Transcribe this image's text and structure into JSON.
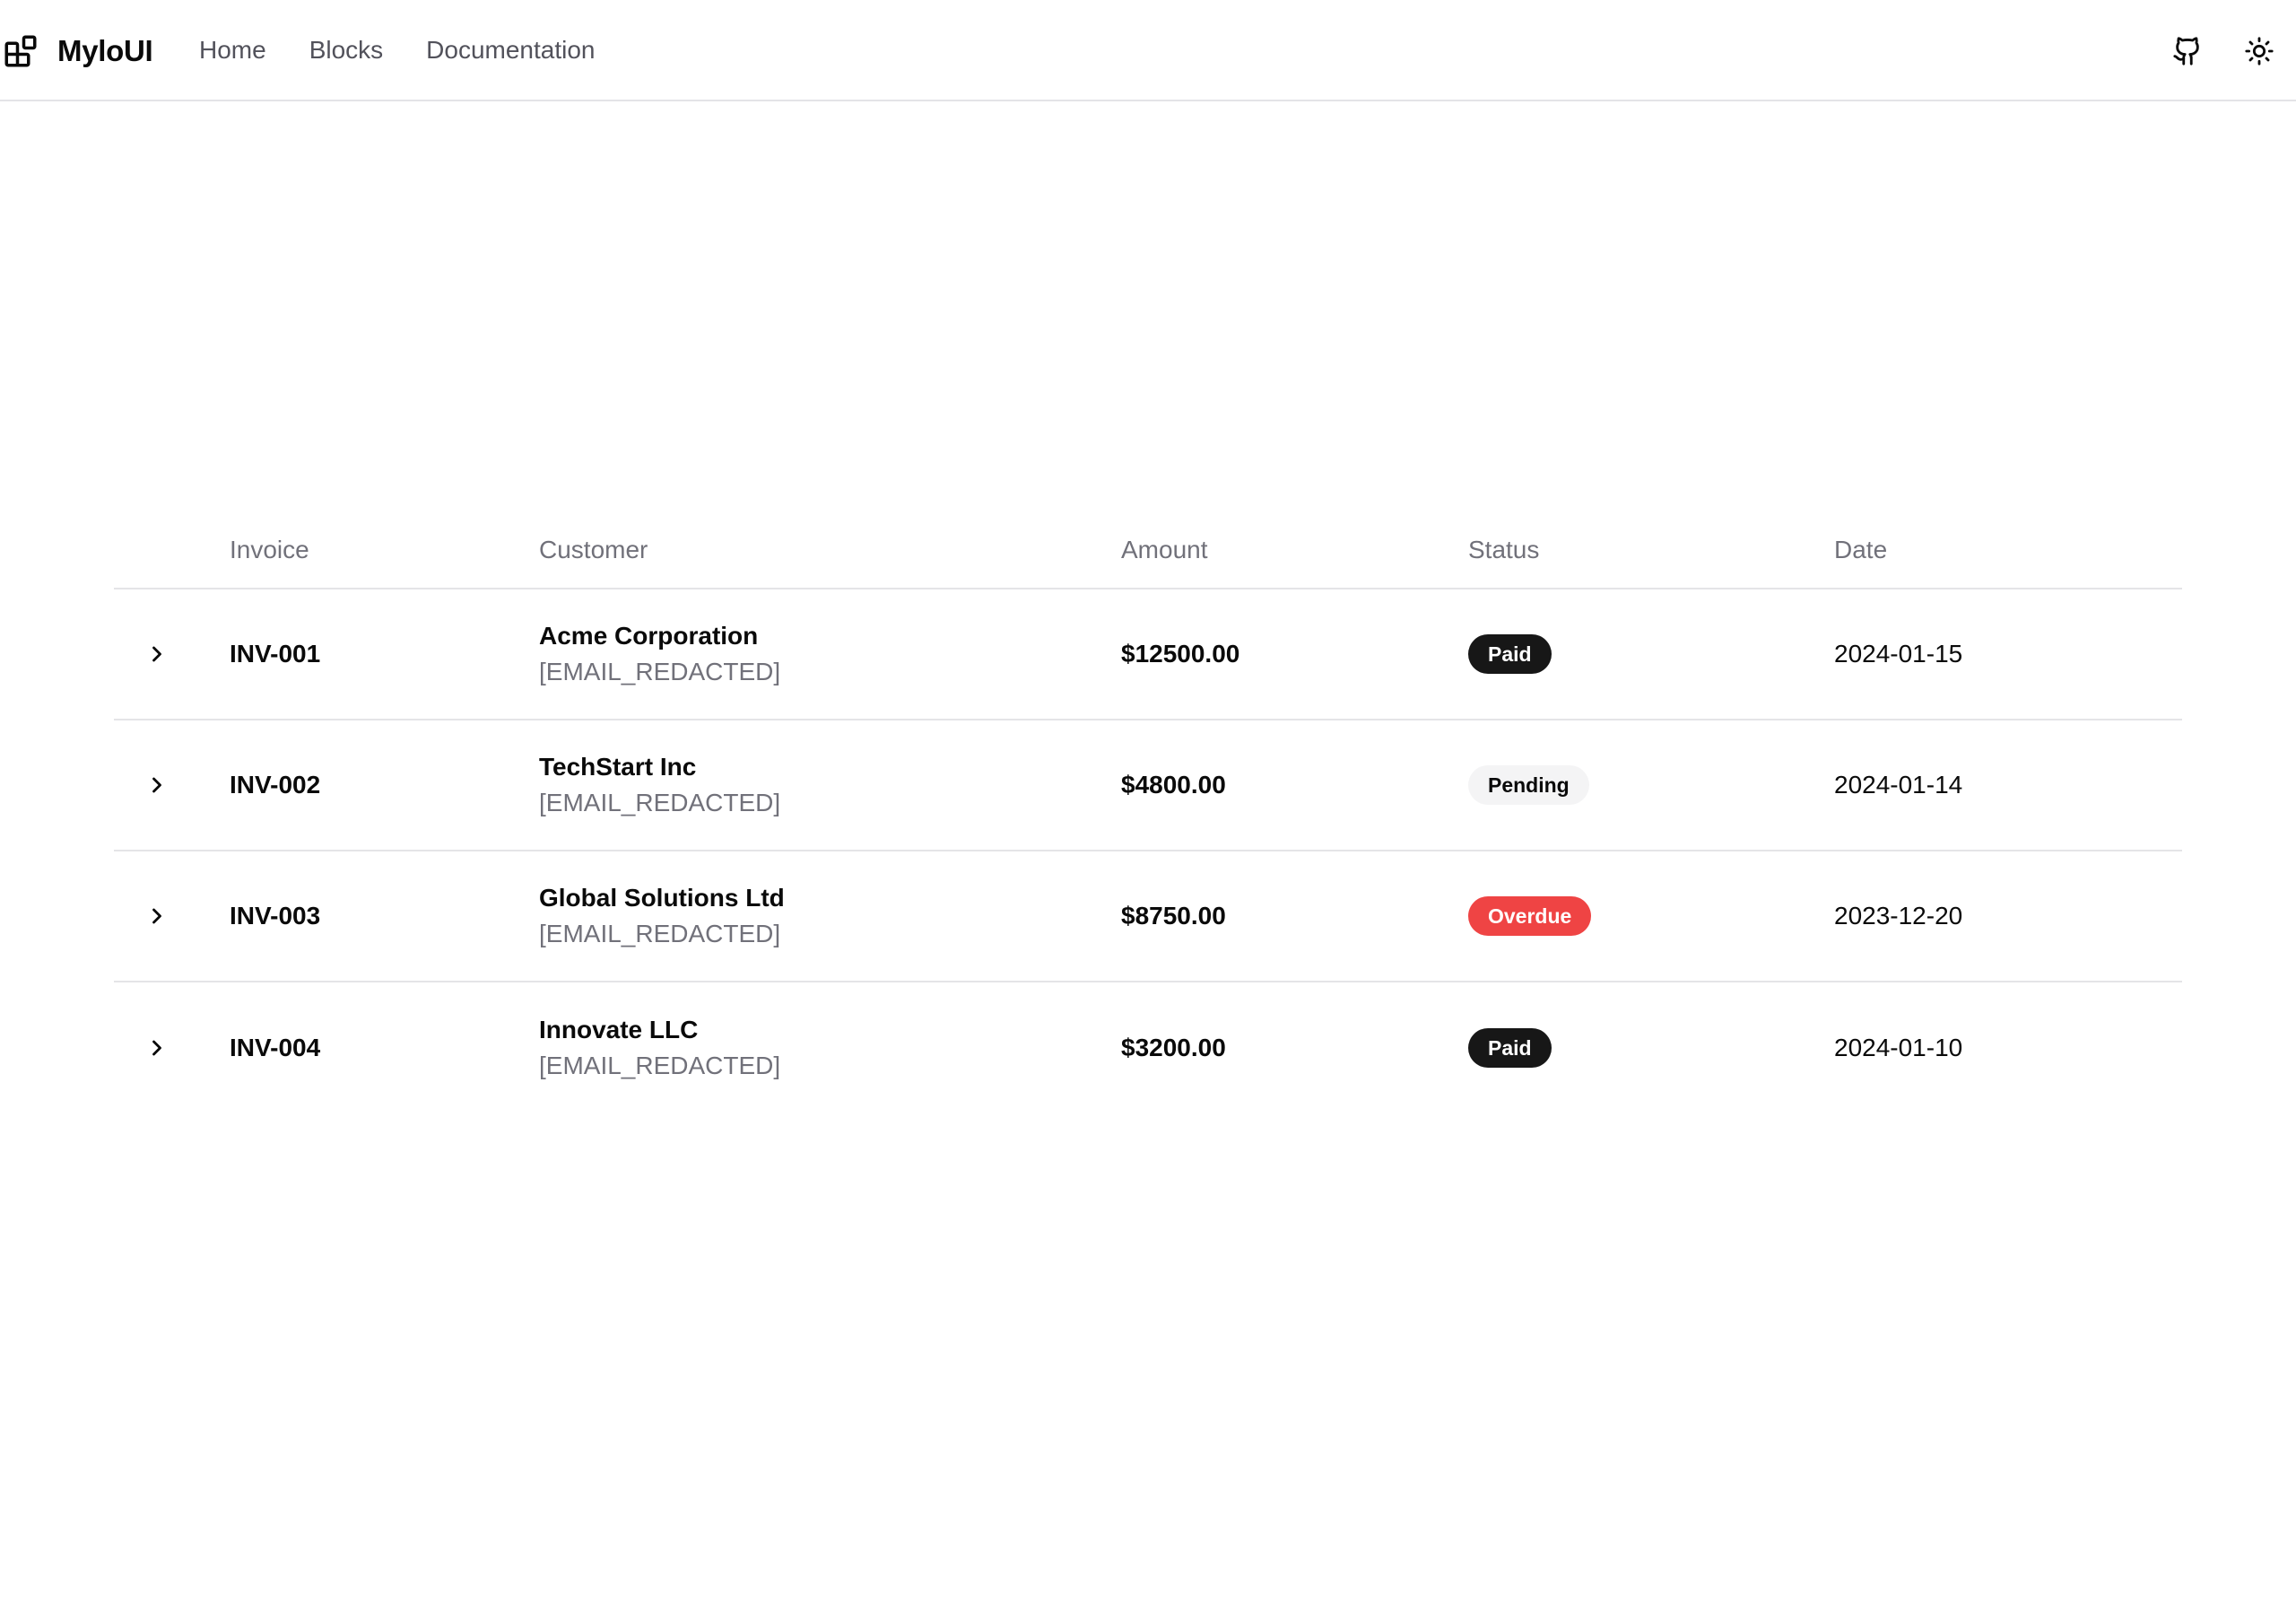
{
  "header": {
    "brand_name": "MyloUI",
    "nav": [
      {
        "label": "Home"
      },
      {
        "label": "Blocks"
      },
      {
        "label": "Documentation"
      }
    ],
    "icons": {
      "github": "github-icon",
      "theme_toggle": "sun-icon"
    }
  },
  "table": {
    "columns": {
      "invoice": "Invoice",
      "customer": "Customer",
      "amount": "Amount",
      "status": "Status",
      "date": "Date"
    },
    "rows": [
      {
        "invoice": "INV-001",
        "customer": "Acme Corporation",
        "email": "[EMAIL_REDACTED]",
        "amount": "$12500.00",
        "status": "Paid",
        "date": "2024-01-15"
      },
      {
        "invoice": "INV-002",
        "customer": "TechStart Inc",
        "email": "[EMAIL_REDACTED]",
        "amount": "$4800.00",
        "status": "Pending",
        "date": "2024-01-14"
      },
      {
        "invoice": "INV-003",
        "customer": "Global Solutions Ltd",
        "email": "[EMAIL_REDACTED]",
        "amount": "$8750.00",
        "status": "Overdue",
        "date": "2023-12-20"
      },
      {
        "invoice": "INV-004",
        "customer": "Innovate LLC",
        "email": "[EMAIL_REDACTED]",
        "amount": "$3200.00",
        "status": "Paid",
        "date": "2024-01-10"
      }
    ],
    "status_styles": {
      "Paid": {
        "bg": "#171717",
        "fg": "#ffffff"
      },
      "Pending": {
        "bg": "#f4f4f5",
        "fg": "#0a0a0a"
      },
      "Overdue": {
        "bg": "#ef4444",
        "fg": "#ffffff"
      }
    }
  }
}
